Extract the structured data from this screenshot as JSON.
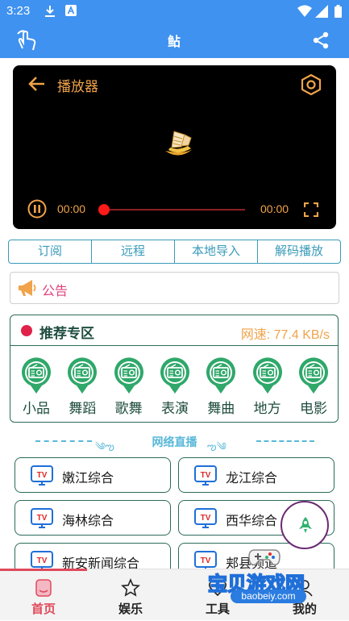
{
  "status_bar": {
    "time": "3:23"
  },
  "app_bar": {
    "title": "鲇"
  },
  "player": {
    "title": "播放器",
    "current_time": "00:00",
    "total_time": "00:00",
    "progress": 0
  },
  "tabs": [
    "订阅",
    "远程",
    "本地导入",
    "解码播放"
  ],
  "notice": {
    "label": "公告"
  },
  "recommend": {
    "title": "推荐专区",
    "speed": "网速: 77.4 KB/s",
    "categories": [
      "小品",
      "舞蹈",
      "歌舞",
      "表演",
      "舞曲",
      "地方",
      "电影"
    ]
  },
  "live_section": {
    "title": "网络直播"
  },
  "channels": [
    "嫩江综合",
    "龙江综合",
    "海林综合",
    "西华综合",
    "新安新闻综合",
    "郏县频道"
  ],
  "tv_badge": "TV",
  "bottom_nav": [
    {
      "label": "首页",
      "active": true
    },
    {
      "label": "娱乐",
      "active": false
    },
    {
      "label": "工具",
      "active": false
    },
    {
      "label": "我的",
      "active": false
    }
  ],
  "watermark": {
    "title": "宝贝游戏网",
    "url": "baobeiy.com"
  },
  "colors": {
    "app_bar": "#3f92f0",
    "accent_orange": "#f0a34a",
    "teal": "#3a9bb8",
    "dark_green": "#2a6b5a",
    "pink": "#e0407a",
    "nav_active": "#e04a5a"
  },
  "icons": {
    "touch": "hand-touch-icon",
    "share": "share-icon",
    "back": "arrow-left-icon",
    "settings": "settings-hexagon-icon",
    "pause": "pause-circle-icon",
    "fullscreen": "fullscreen-icon",
    "notice": "megaphone-icon",
    "category": "radio-icon",
    "tv": "tv-icon",
    "fab": "rocket-icon"
  }
}
